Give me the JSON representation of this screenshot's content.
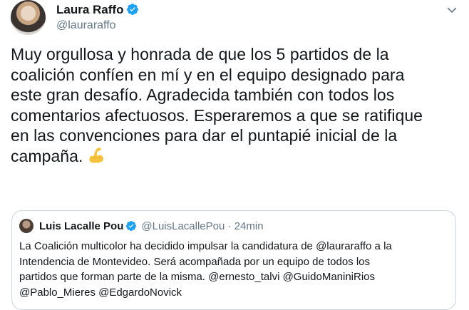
{
  "tweet": {
    "author_name": "Laura Raffo",
    "author_handle": "@lauraraffo",
    "text": "Muy orgullosa y honrada de que los 5 partidos de la\ncoalición confíen en mí y en el equipo designado para\neste gran desafío. Agradecida también con todos los\ncomentarios afectuosos. Esperaremos a que se ratifique\nen las convenciones para dar el puntapié inicial de la\ncampaña.",
    "emoji": "flexed-biceps"
  },
  "quoted_tweet": {
    "author_name": "Luis Lacalle Pou",
    "author_handle": "@LuisLacallePou",
    "separator": "·",
    "time": "24min",
    "text": "La Coalición multicolor ha decidido impulsar la candidatura de @lauraraffo a la\nIntendencia de Montevideo. Será acompañada por un equipo de todos los\npartidos que forman parte de la misma. @ernesto_talvi @GuidoManiniRios\n@Pablo_Mieres @EdgardoNovick"
  },
  "icons": {
    "verified": "verified-badge-icon",
    "menu": "chevron-down-icon"
  },
  "colors": {
    "verified": "#1da1f2",
    "secondary_text": "#657786",
    "border": "#ccd6dd",
    "emoji": "#f5c33b"
  }
}
